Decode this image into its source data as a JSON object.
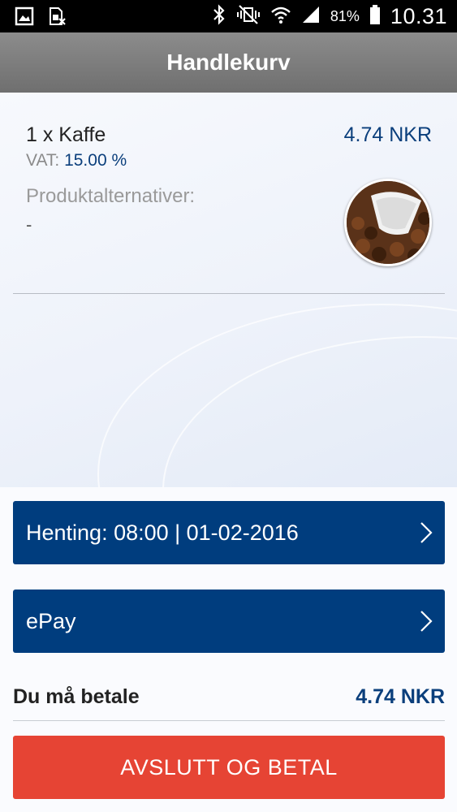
{
  "status_bar": {
    "icons": [
      "gallery-icon",
      "sim-card-off-icon",
      "bluetooth-icon",
      "vibrate-mute-icon",
      "wifi-icon",
      "signal-icon",
      "battery-icon"
    ],
    "battery_percent": "81%",
    "time": "10.31"
  },
  "app_bar": {
    "title": "Handlekurv"
  },
  "cart_item": {
    "name": "1 x Kaffe",
    "price": "4.74 NKR",
    "vat_label": "VAT:",
    "vat_value": "15.00 %",
    "options_label": "Produktalternativer:",
    "options_value": "-",
    "image_icon": "coffee-beans-image"
  },
  "pickup_button": {
    "label": "Henting: 08:00 | 01-02-2016",
    "icon": "chevron-right-icon"
  },
  "payment_button": {
    "label": "ePay",
    "icon": "chevron-right-icon"
  },
  "total": {
    "label": "Du må betale",
    "value": "4.74 NKR"
  },
  "checkout_button": {
    "label": "AVSLUTT OG BETAL"
  },
  "colors": {
    "primary": "#003d7e",
    "accent_text": "#0b3f7c",
    "checkout": "#e64434",
    "app_bar": "#7c7c7c"
  }
}
